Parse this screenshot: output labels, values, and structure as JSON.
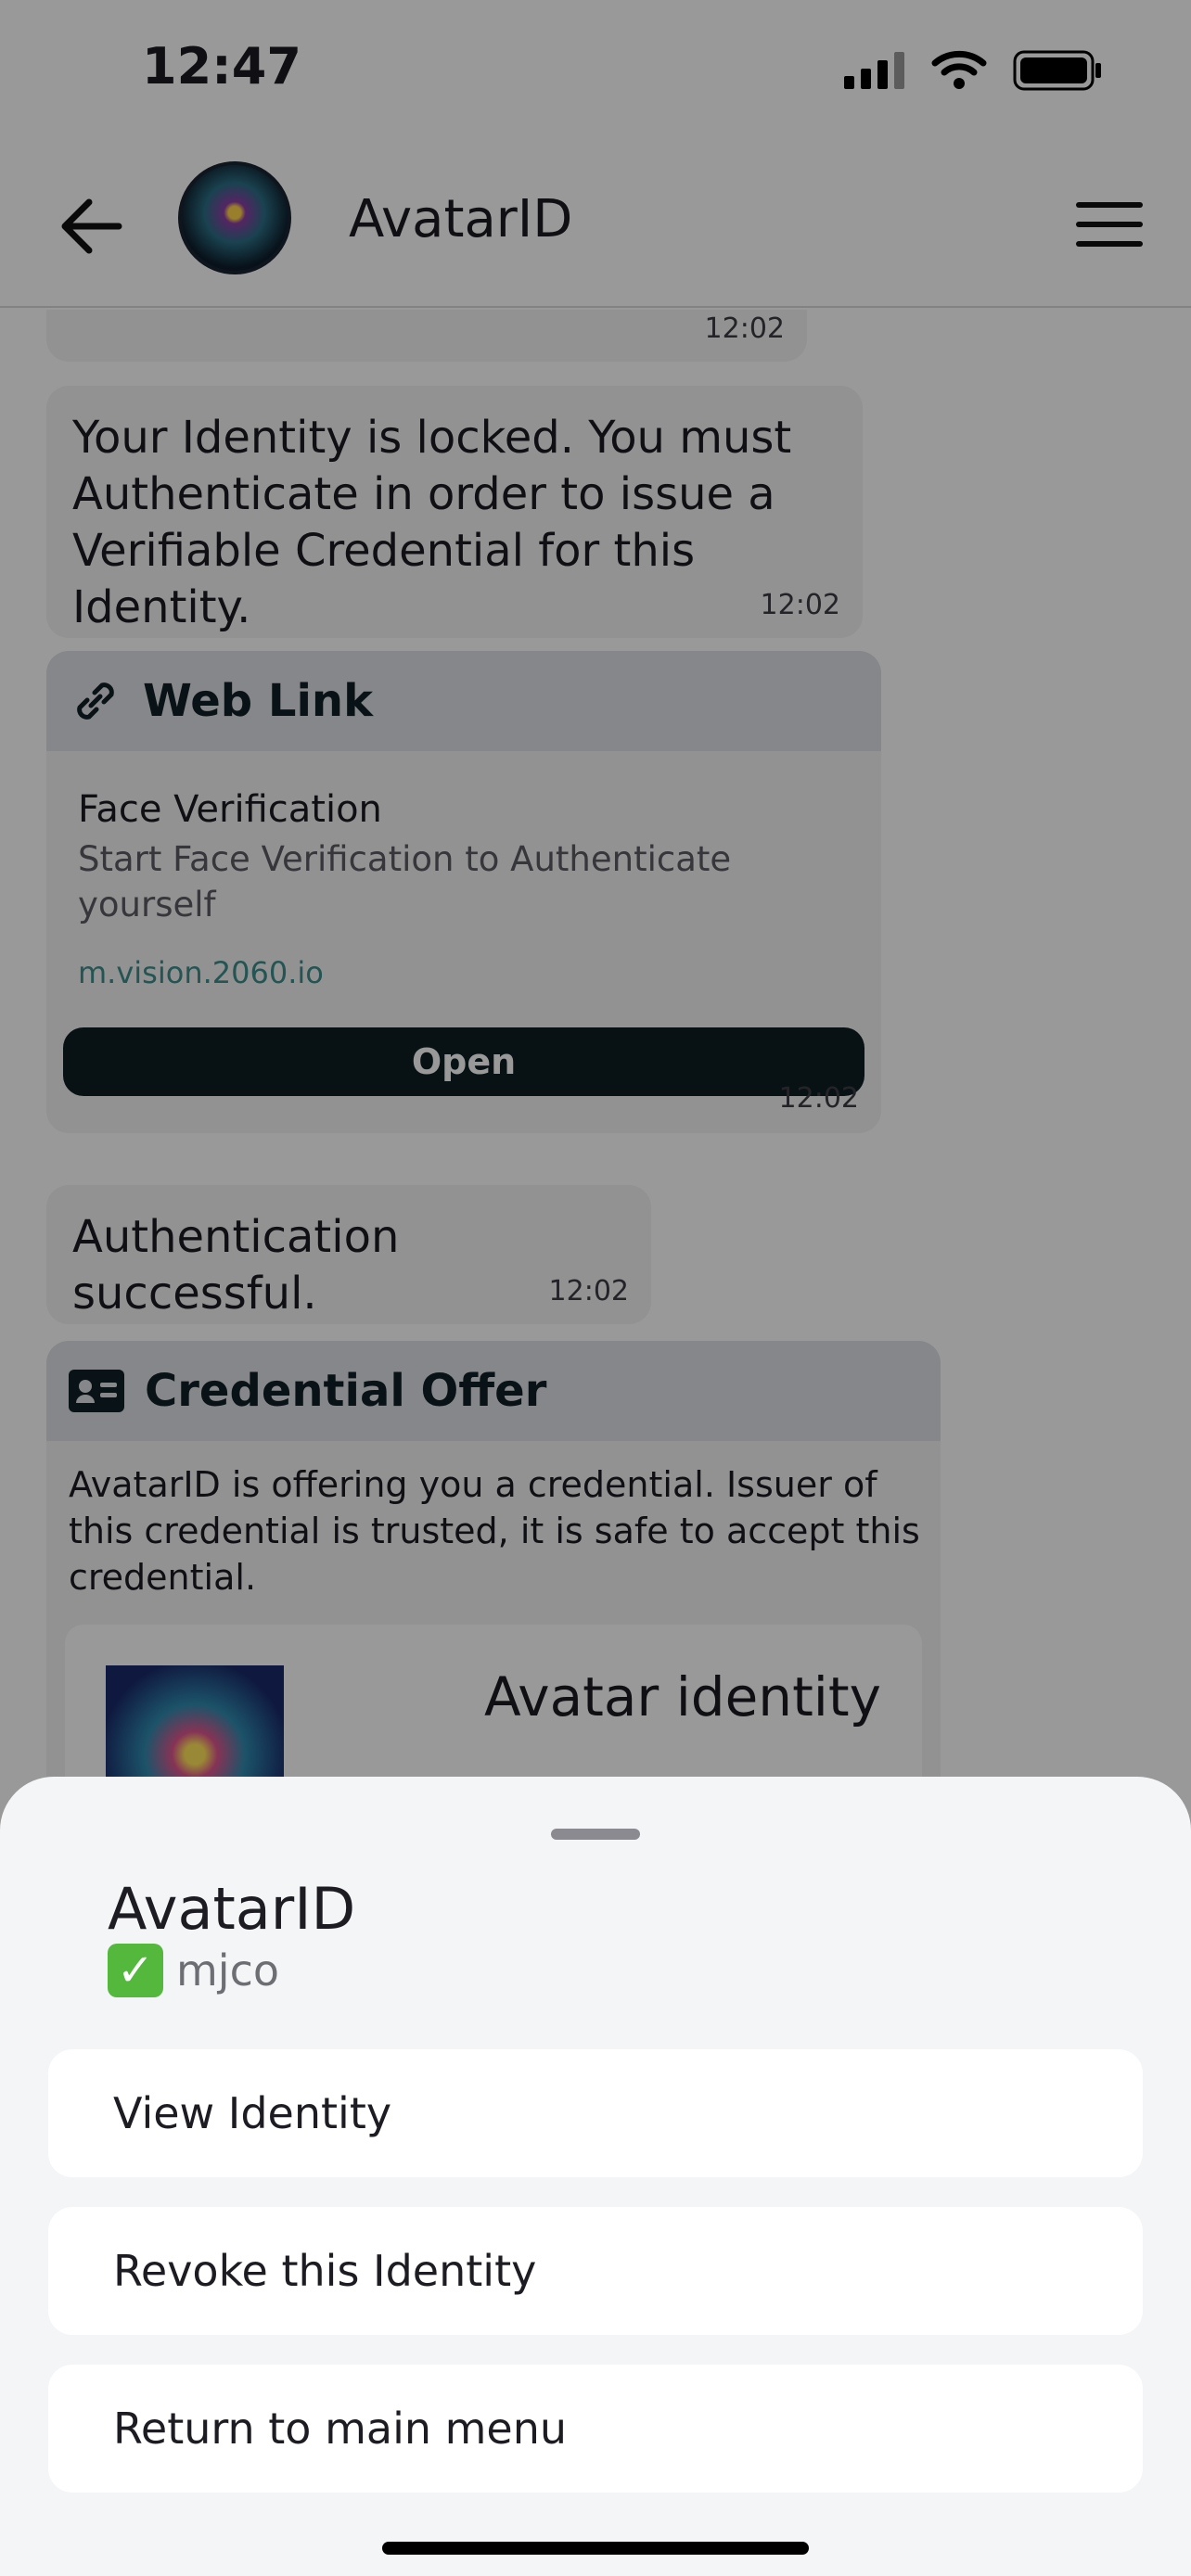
{
  "status_bar": {
    "time": "12:47"
  },
  "header": {
    "title": "AvatarID"
  },
  "chat": {
    "top_timestamp": "12:02",
    "locked_message": {
      "text": "Your Identity is locked. You must Authenticate in order to issue a Verifiable Credential for this Identity.",
      "time": "12:02"
    },
    "web_link": {
      "header": "Web Link",
      "title": "Face Verification",
      "description": "Start Face Verification to Authenticate yourself",
      "url": "m.vision.2060.io",
      "button": "Open",
      "time": "12:02"
    },
    "auth_message": {
      "text": "Authentication successful.",
      "time": "12:02"
    },
    "credential_offer": {
      "header": "Credential Offer",
      "text": "AvatarID is offering you a credential. Issuer of this credential is trusted, it is safe to accept this credential.",
      "credential_name": "Avatar identity"
    }
  },
  "sheet": {
    "title": "AvatarID",
    "check_glyph": "✓",
    "subtitle": "mjco",
    "actions": [
      "View Identity",
      "Revoke this Identity",
      "Return to main menu"
    ]
  }
}
